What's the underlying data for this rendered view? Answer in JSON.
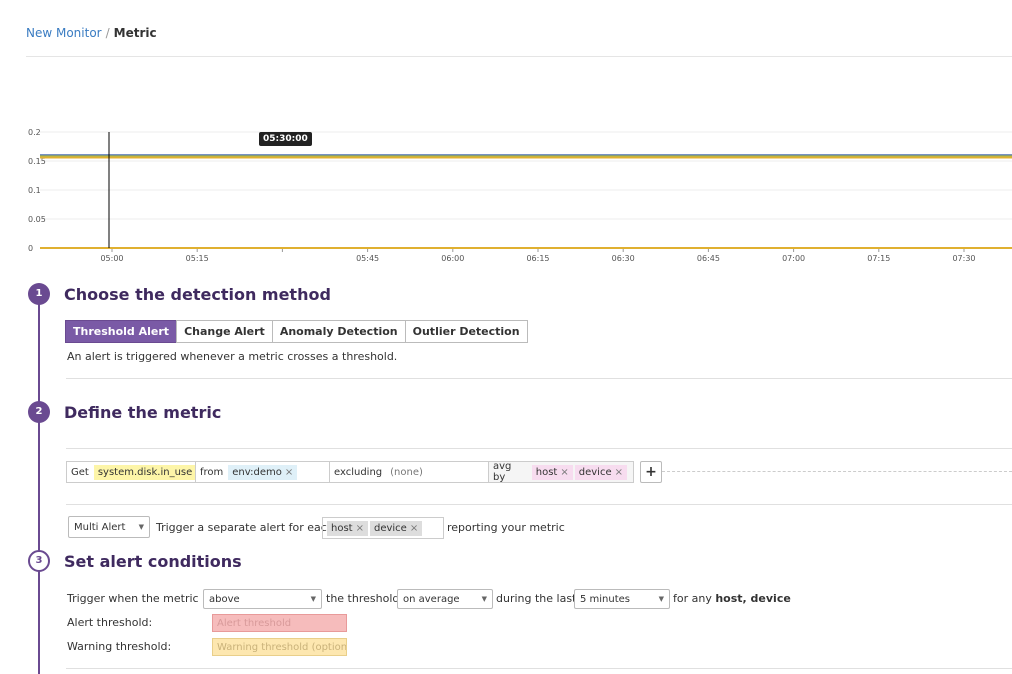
{
  "breadcrumb": {
    "parent": "New Monitor",
    "separator": "/",
    "current": "Metric"
  },
  "chart_data": {
    "type": "line",
    "y_ticks": [
      "0.2",
      "0.15",
      "0.1",
      "0.05",
      "0"
    ],
    "x_ticks": [
      "05:00",
      "05:15",
      "05:30:00",
      "05:45",
      "06:00",
      "06:15",
      "06:30",
      "06:45",
      "07:00",
      "07:15",
      "07:30"
    ],
    "ylim": [
      0,
      0.2
    ],
    "series": [
      {
        "values": [
          0.16,
          0.16
        ],
        "color": "#4a6fb0"
      },
      {
        "values": [
          0.158,
          0.158
        ],
        "color": "#a9b84e"
      },
      {
        "values": [
          0.156,
          0.156
        ],
        "color": "#e0b030"
      },
      {
        "values": [
          0,
          0
        ],
        "color": "#e0b030"
      }
    ],
    "cursor_label": "05:30:00"
  },
  "steps": [
    {
      "num": "1",
      "title": "Choose the detection method"
    },
    {
      "num": "2",
      "title": "Define the metric"
    },
    {
      "num": "3",
      "title": "Set alert conditions"
    }
  ],
  "detection": {
    "buttons": [
      "Threshold Alert",
      "Change Alert",
      "Anomaly Detection",
      "Outlier Detection"
    ],
    "description": "An alert is triggered whenever a metric crosses a threshold."
  },
  "query": {
    "get_label": "Get",
    "metric": "system.disk.in_use",
    "from_label": "from",
    "from_tag": "env:demo",
    "excluding_label": "excluding",
    "excluding_value": "(none)",
    "avg_label": "avg by",
    "avg_tags": [
      "host",
      "device"
    ],
    "remove": "×",
    "plus": "+"
  },
  "multi_alert": {
    "select": "Multi Alert",
    "text": "Trigger a separate alert for each",
    "tags": [
      "host",
      "device"
    ],
    "suffix": "reporting your metric"
  },
  "conditions": {
    "trigger_text": "Trigger when the metric is",
    "above": "above",
    "threshold_text": "the threshold",
    "on_average": "on average",
    "during_text": "during the last",
    "duration": "5 minutes",
    "for_any": "for any",
    "group": "host, device",
    "alert_label": "Alert threshold:",
    "alert_placeholder": "Alert threshold",
    "warning_label": "Warning threshold:",
    "warning_placeholder": "Warning threshold (optiona"
  }
}
